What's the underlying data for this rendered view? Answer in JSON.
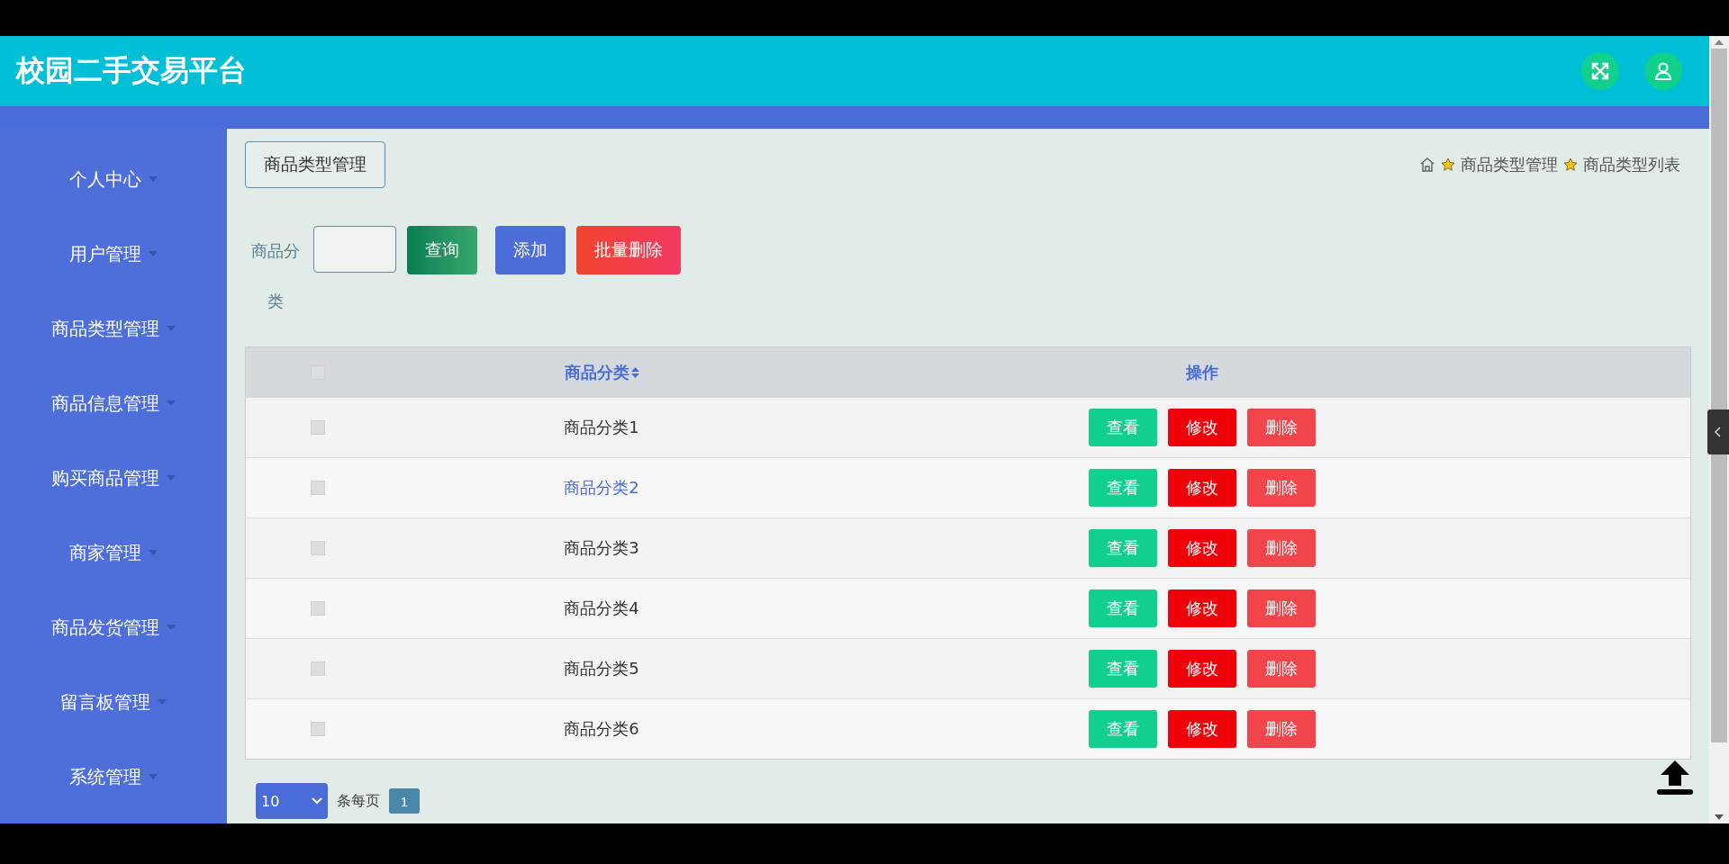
{
  "header": {
    "title": "校园二手交易平台"
  },
  "sidebar": {
    "items": [
      {
        "label": "个人中心"
      },
      {
        "label": "用户管理"
      },
      {
        "label": "商品类型管理"
      },
      {
        "label": "商品信息管理"
      },
      {
        "label": "购买商品管理"
      },
      {
        "label": "商家管理"
      },
      {
        "label": "商品发货管理"
      },
      {
        "label": "留言板管理"
      },
      {
        "label": "系统管理"
      }
    ]
  },
  "page_title": "商品类型管理",
  "breadcrumb": [
    "商品类型管理",
    "商品类型列表"
  ],
  "search": {
    "label": "商品分类",
    "buttons": [
      {
        "label": "查询",
        "kind": "query"
      },
      {
        "label": "添加",
        "kind": "add"
      },
      {
        "label": "批量删除",
        "kind": "delete"
      }
    ]
  },
  "table": {
    "columns": [
      "商品分类",
      "操作"
    ],
    "header_checked": false,
    "rows": [
      {
        "name": "商品分类1",
        "checked": false,
        "hovered": false,
        "actions": [
          "查看",
          "修改",
          "删除"
        ]
      },
      {
        "name": "商品分类2",
        "checked": false,
        "hovered": true,
        "actions": [
          "查看",
          "修改",
          "删除"
        ]
      },
      {
        "name": "商品分类3",
        "checked": false,
        "hovered": false,
        "actions": [
          "查看",
          "修改",
          "删除"
        ]
      },
      {
        "name": "商品分类4",
        "checked": false,
        "hovered": false,
        "actions": [
          "查看",
          "修改",
          "删除"
        ]
      },
      {
        "name": "商品分类5",
        "checked": false,
        "hovered": false,
        "actions": [
          "查看",
          "修改",
          "删除"
        ]
      },
      {
        "name": "商品分类6",
        "checked": false,
        "hovered": false,
        "actions": [
          "查看",
          "修改",
          "删除"
        ]
      }
    ]
  },
  "pagination": {
    "page_size": "10",
    "page_size_label": "条每页",
    "pages": [
      {
        "label": "1",
        "selected": true
      }
    ]
  }
}
